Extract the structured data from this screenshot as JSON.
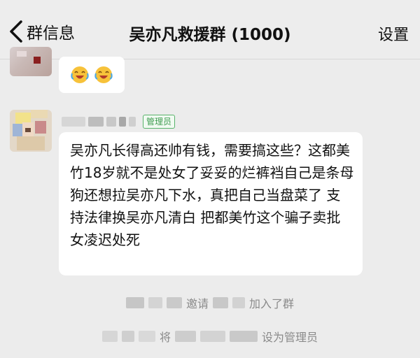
{
  "header": {
    "back_label": "群信息",
    "title": "吴亦凡救援群 (1000)",
    "settings_label": "设置"
  },
  "messages": {
    "admin_badge": "管理员",
    "main_text": "吴亦凡长得高还帅有钱，需要搞这些？这都美竹18岁就不是处女了妥妥的烂裤裆自己是条母狗还想拉吴亦凡下水，真把自己当盘菜了 支持法律换吴亦凡清白 把都美竹这个骗子卖批女凌迟处死"
  },
  "system_notices": {
    "invite_verb": "邀请",
    "joined_text": "加入了群",
    "set_prefix": "将",
    "set_suffix": "设为管理员"
  },
  "colors": {
    "background": "#ececec",
    "bubble": "#ffffff",
    "badge_green": "#3f9c50"
  }
}
